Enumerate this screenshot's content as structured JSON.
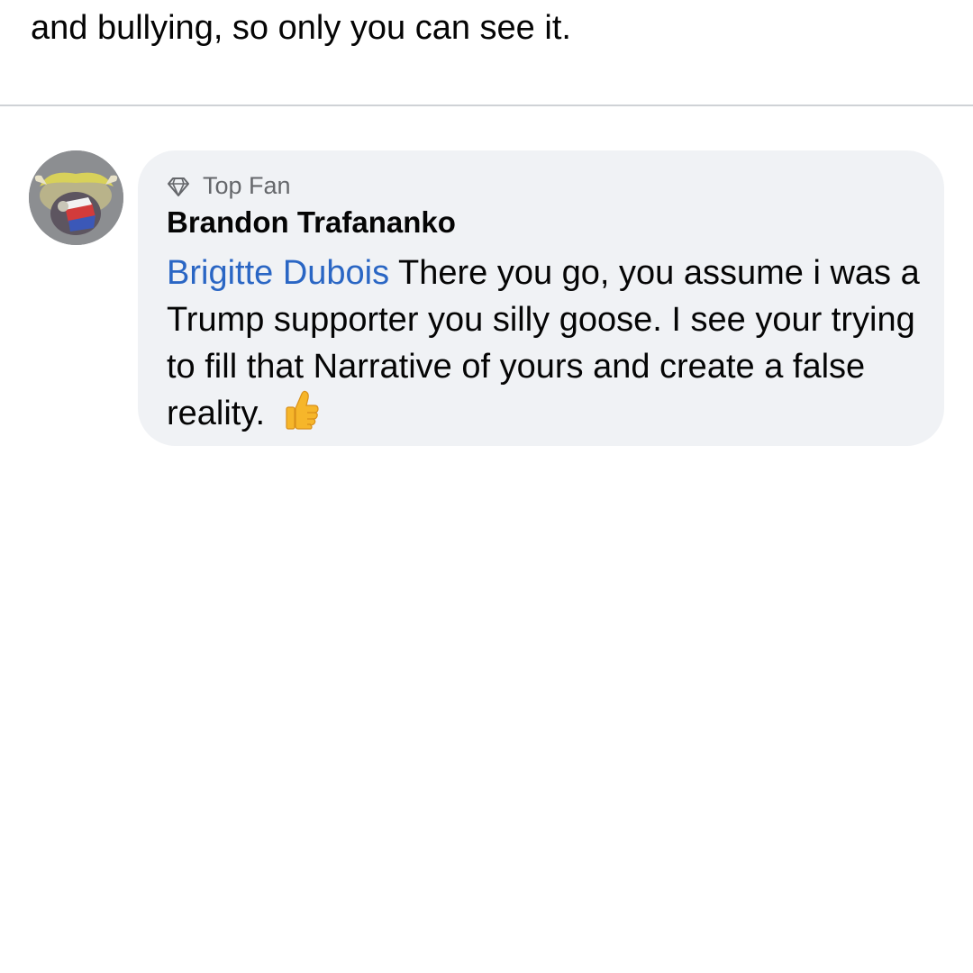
{
  "notice_text": "and bullying, so only you can see it.",
  "comment": {
    "badge": {
      "icon": "diamond-icon",
      "label": "Top Fan"
    },
    "author": "Brandon Trafananko",
    "mention": "Brigitte Dubois",
    "text": " There you go, you assume i was a Trump supporter you silly goose. I see your trying to fill that Narrative of yours and create a false reality. ",
    "emoji": "thumbs-up-icon"
  },
  "colors": {
    "bubble_background": "#f0f2f5",
    "mention": "#2a66c4",
    "badge_text": "#65676b",
    "divider": "#cfd2d6"
  }
}
